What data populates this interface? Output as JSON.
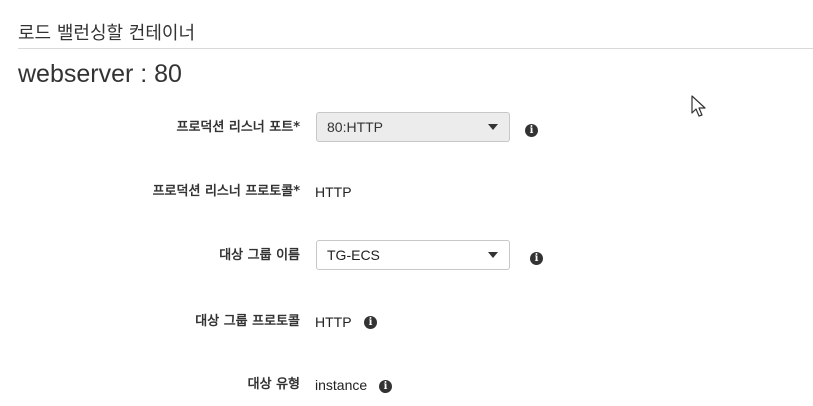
{
  "section": {
    "title": "로드 밸런싱할 컨테이너"
  },
  "container": {
    "name": "webserver : 80"
  },
  "fields": {
    "prod_listener_port": {
      "label": "프로덕션 리스너 포트*",
      "selected": "80:HTTP"
    },
    "prod_listener_protocol": {
      "label": "프로덕션 리스너 프로토콜*",
      "value": "HTTP"
    },
    "target_group_name": {
      "label": "대상 그룹 이름",
      "selected": "TG-ECS"
    },
    "target_group_protocol": {
      "label": "대상 그룹 프로토콜",
      "value": "HTTP"
    },
    "target_type": {
      "label": "대상 유형",
      "value": "instance"
    }
  },
  "icons": {
    "info": "i"
  }
}
